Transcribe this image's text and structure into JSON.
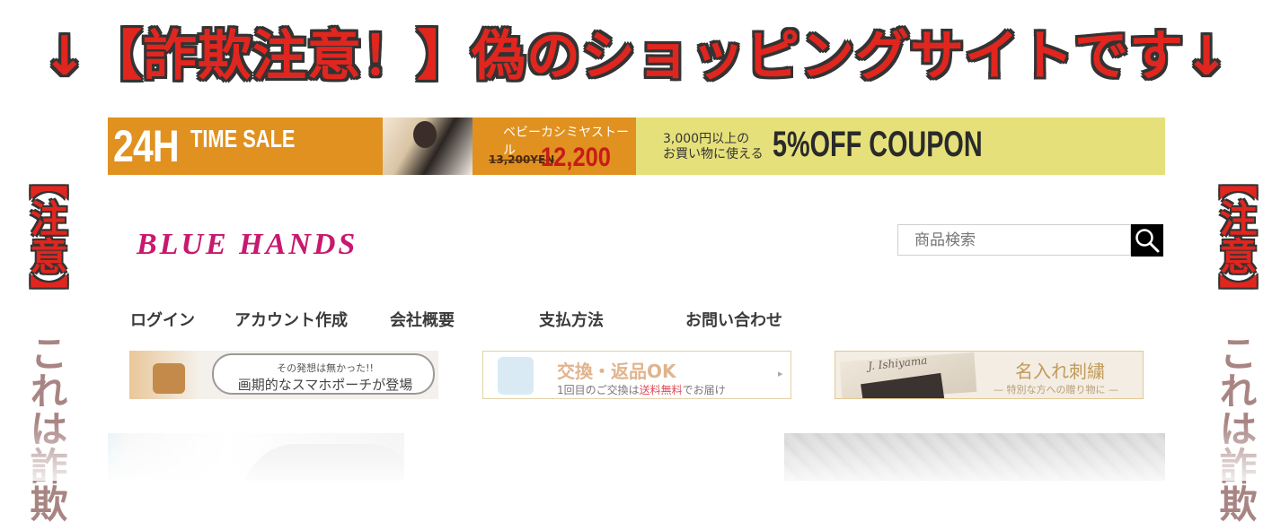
{
  "warning": {
    "headline": "↓【詐欺注意！】偽のショッピングサイトです↓",
    "side_label": "【注意】",
    "side_text": "これは詐欺"
  },
  "promo": {
    "sale_24h": "24H",
    "sale_time": "TIME SALE",
    "stole_name": "ベビーカシミヤストール",
    "old_price": "13,200YEN",
    "new_price": "12,200 YEN",
    "coupon_sub_1": "3,000円以上の",
    "coupon_sub_2": "お買い物に使える",
    "coupon_main": "5%OFF COUPON"
  },
  "header": {
    "logo": "BLUE HANDS",
    "search_placeholder": "商品検索",
    "search_icon": "search-icon"
  },
  "nav": {
    "items": [
      "ログイン",
      "アカウント作成",
      "会社概要",
      "支払方法",
      "お問い合わせ"
    ]
  },
  "features": {
    "f1_small": "その発想は無かった!!",
    "f1_big": "画期的なスマホポーチが登場",
    "f2_title": "交換・返品OK",
    "f2_sub_a": "1回目のご交換は",
    "f2_sub_red": "送料無料",
    "f2_sub_b": "でお届け",
    "f2_arrow": "▸",
    "f3_sign": "J. Ishiyama",
    "f3_title": "名入れ刺繍",
    "f3_sub": "— 特別な方への贈り物に —"
  },
  "colors": {
    "warning_red": "#e0261f",
    "logo_pink": "#c8186f",
    "promo_orange": "#e0911f",
    "promo_yellow": "#e6e07a"
  }
}
